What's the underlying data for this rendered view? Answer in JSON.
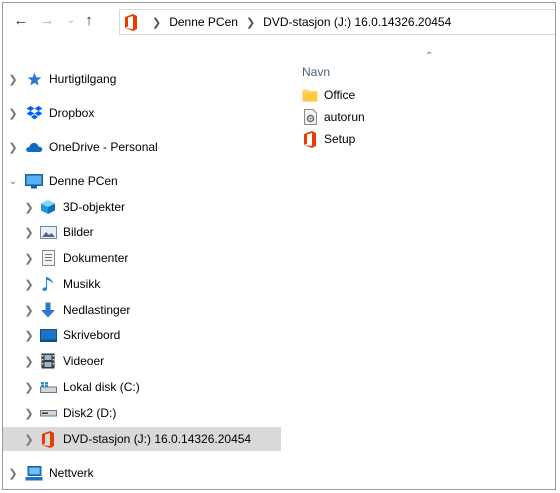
{
  "window": {
    "breadcrumb": [
      "Denne PCen",
      "DVD-stasjon (J:) 16.0.14326.20454"
    ],
    "colors": {
      "office_red": "#eb3c00",
      "selection": "#cce4f7",
      "hover": "#d9d9d9"
    }
  },
  "navigation": {
    "back_icon": "back-arrow-icon",
    "forward_icon": "forward-arrow-icon",
    "recent_icon": "chevron-down-icon",
    "up_icon": "up-arrow-icon"
  },
  "nav_pane": {
    "items": [
      {
        "label": "Hurtigtilgang",
        "icon": "star-icon"
      },
      {
        "label": "Dropbox",
        "icon": "dropbox-icon"
      },
      {
        "label": "OneDrive - Personal",
        "icon": "cloud-icon"
      },
      {
        "label": "Denne PCen",
        "icon": "computer-icon"
      },
      {
        "label": "3D-objekter",
        "icon": "cube-icon"
      },
      {
        "label": "Bilder",
        "icon": "pictures-icon"
      },
      {
        "label": "Dokumenter",
        "icon": "document-icon"
      },
      {
        "label": "Musikk",
        "icon": "music-icon"
      },
      {
        "label": "Nedlastinger",
        "icon": "download-icon"
      },
      {
        "label": "Skrivebord",
        "icon": "desktop-icon"
      },
      {
        "label": "Videoer",
        "icon": "film-icon"
      },
      {
        "label": "Lokal disk (C:)",
        "icon": "drive-icon"
      },
      {
        "label": "Disk2 (D:)",
        "icon": "drive-icon"
      },
      {
        "label": "DVD-stasjon (J:) 16.0.14326.20454",
        "icon": "office-icon"
      },
      {
        "label": "Nettverk",
        "icon": "network-icon"
      }
    ]
  },
  "content": {
    "column_name": "Navn",
    "files": [
      {
        "name": "Office",
        "icon": "folder-icon"
      },
      {
        "name": "autorun",
        "icon": "settings-file-icon"
      },
      {
        "name": "Setup",
        "icon": "office-icon"
      }
    ]
  }
}
